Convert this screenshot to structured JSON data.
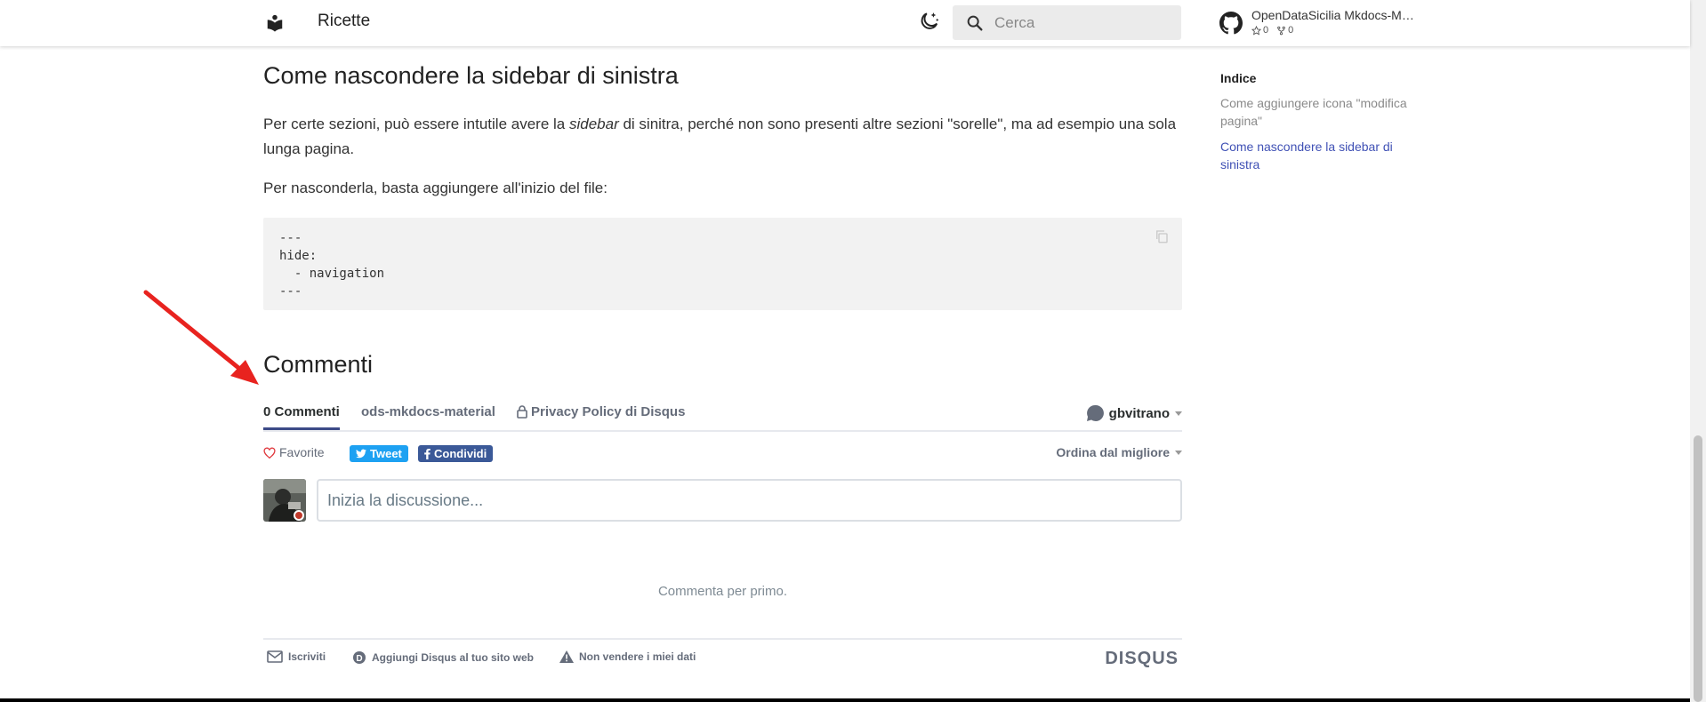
{
  "header": {
    "site_title": "Ricette",
    "search_placeholder": "Cerca",
    "repo": {
      "name": "OpenDataSicilia Mkdocs-M…",
      "stars": "0",
      "forks": "0"
    }
  },
  "content": {
    "section_title": "Come nascondere la sidebar di sinistra",
    "para1": {
      "before": "Per certe sezioni, può essere intutile avere la ",
      "em": "sidebar",
      "after": " di sinitra, perché non sono presenti altre sezioni \"sorelle\", ma ad esempio una sola lunga pagina."
    },
    "para2": "Per nasconderla, basta aggiungere all'inizio del file:",
    "code_lines": [
      "---",
      "hide:",
      "  - navigation",
      "---"
    ],
    "comments_title": "Commenti"
  },
  "disqus": {
    "tabs": [
      "0 Commenti",
      "ods-mkdocs-material",
      "Privacy Policy di Disqus"
    ],
    "user": "gbvitrano",
    "favorite": "Favorite",
    "tweet": "Tweet",
    "share": "Condividi",
    "sort": "Ordina dal migliore",
    "composer_placeholder": "Inizia la discussione...",
    "empty": "Commenta per primo.",
    "footer": {
      "subscribe": "Iscriviti",
      "add": "Aggiungi Disqus al tuo sito web",
      "dont_sell": "Non vendere i miei dati",
      "logo": "DISQUS"
    }
  },
  "toc": {
    "title": "Indice",
    "items": [
      {
        "label": "Come aggiungere icona \"modifica pagina\""
      },
      {
        "label": "Come nascondere la sidebar di sinistra"
      }
    ]
  },
  "colors": {
    "accent": "#4051b5",
    "annotation_arrow": "#e8231f",
    "tweet": "#1da1f2",
    "facebook": "#3b5998"
  },
  "icons": [
    "book-icon",
    "dark-mode-icon",
    "search-icon",
    "github-icon",
    "star-icon",
    "fork-icon",
    "copy-icon",
    "lock-icon",
    "chat-bubble-icon",
    "heart-icon",
    "twitter-icon",
    "facebook-icon",
    "mail-icon",
    "disqus-d-icon",
    "warning-icon",
    "red-arrow"
  ]
}
